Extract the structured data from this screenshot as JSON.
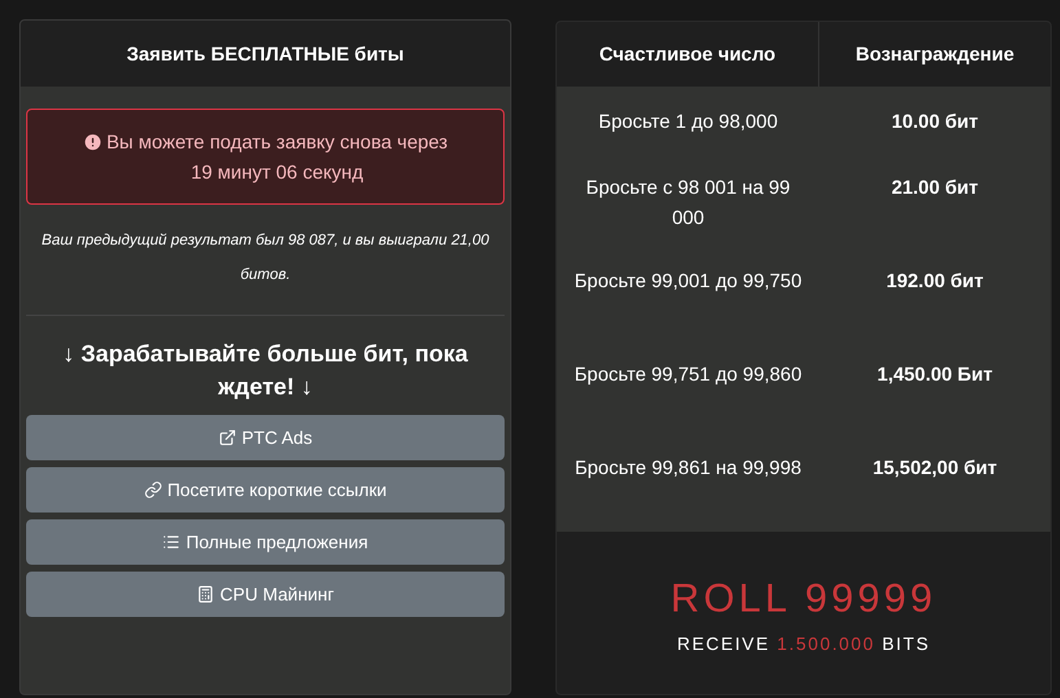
{
  "claim_card": {
    "title": "Заявить БЕСПЛАТНЫЕ биты",
    "alert": "Вы можете подать заявку снова через 19 минут 06 секунд",
    "previous_result": "Ваш предыдущий результат был 98 087, и вы выиграли 21,00 битов.",
    "earn_heading": "↓ Зарабатывайте больше бит, пока ждете! ↓",
    "buttons": [
      {
        "kind": "external",
        "label": "PTC Ads"
      },
      {
        "kind": "link",
        "label": "Посетите короткие ссылки"
      },
      {
        "kind": "list",
        "label": "Полные предложения"
      },
      {
        "kind": "calculator",
        "label": "CPU Майнинг"
      }
    ]
  },
  "rewards_table": {
    "columns": [
      "Счастливое число",
      "Вознаграждение"
    ],
    "rows": [
      {
        "roll": "Бросьте 1 до 98,000",
        "reward": "10.00 бит"
      },
      {
        "roll": "Бросьте с 98 001 на 99 000",
        "reward": "21.00 бит"
      },
      {
        "roll": "Бросьте 99,001 до 99,750",
        "reward": "192.00 бит"
      },
      {
        "roll": "Бросьте 99,751 до 99,860",
        "reward": "1,450.00 Бит"
      },
      {
        "roll": "Бросьте 99,861 на 99,998",
        "reward": "15,502,00 бит"
      }
    ],
    "jackpot": {
      "title": "ROLL 99999",
      "receive_before": "RECEIVE",
      "amount": "1.500.000",
      "receive_after": "BITS"
    }
  }
}
